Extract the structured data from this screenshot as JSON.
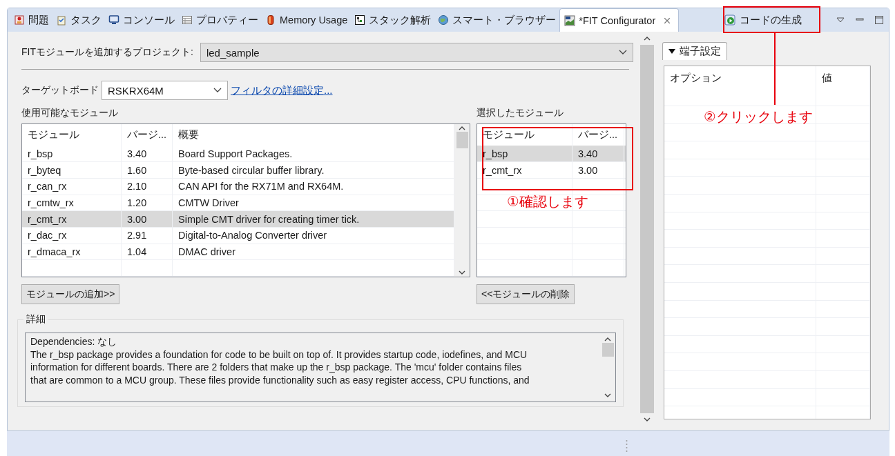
{
  "tabs": [
    {
      "label": "問題",
      "selected": false
    },
    {
      "label": "タスク",
      "selected": false
    },
    {
      "label": "コンソール",
      "selected": false
    },
    {
      "label": "プロパティー",
      "selected": false
    },
    {
      "label": "Memory Usage",
      "selected": false
    },
    {
      "label": "スタック解析",
      "selected": false
    },
    {
      "label": "スマート・ブラウザー",
      "selected": false
    },
    {
      "label": "*FIT Configurator",
      "selected": true
    }
  ],
  "toolbar": {
    "generate_button": "コードの生成"
  },
  "project": {
    "label": "FITモジュールを追加するプロジェクト:",
    "value": "led_sample"
  },
  "target_board": {
    "label": "ターゲットボード",
    "value": "RSKRX64M",
    "filter_link": "フィルタの詳細設定..."
  },
  "available_modules": {
    "title": "使用可能なモジュール",
    "columns": [
      "モジュール",
      "バージ...",
      "概要"
    ],
    "rows": [
      {
        "cells": [
          "r_bsp",
          "3.40",
          "Board Support Packages."
        ],
        "selected": false
      },
      {
        "cells": [
          "r_byteq",
          "1.60",
          "Byte-based circular buffer library."
        ],
        "selected": false
      },
      {
        "cells": [
          "r_can_rx",
          "2.10",
          "CAN API for the RX71M and RX64M."
        ],
        "selected": false
      },
      {
        "cells": [
          "r_cmtw_rx",
          "1.20",
          "CMTW Driver"
        ],
        "selected": false
      },
      {
        "cells": [
          "r_cmt_rx",
          "3.00",
          "Simple CMT driver for creating timer tick."
        ],
        "selected": true
      },
      {
        "cells": [
          "r_dac_rx",
          "2.91",
          "Digital-to-Analog Converter driver"
        ],
        "selected": false
      },
      {
        "cells": [
          "r_dmaca_rx",
          "1.04",
          "DMAC driver"
        ],
        "selected": false
      }
    ],
    "add_button": "モジュールの追加>>"
  },
  "selected_modules": {
    "title": "選択したモジュール",
    "columns": [
      "モジュール",
      "バージ..."
    ],
    "rows": [
      {
        "cells": [
          "r_bsp",
          "3.40"
        ],
        "selected": true
      },
      {
        "cells": [
          "r_cmt_rx",
          "3.00"
        ],
        "selected": false
      }
    ],
    "remove_button": "<<モジュールの削除"
  },
  "details": {
    "title": "詳細",
    "lines": [
      "Dependencies: なし",
      "The r_bsp package provides a foundation for code to be built on top of. It provides startup code, iodefines, and MCU",
      "information for different boards. There are 2 folders that make up the r_bsp package. The 'mcu' folder contains files",
      "that are common to a MCU group. These files provide functionality such as easy register access, CPU functions, and"
    ]
  },
  "pin_settings": {
    "section": "端子設定",
    "expanded": true,
    "columns": [
      "オプション",
      "値"
    ]
  },
  "annotations": [
    {
      "text": "①確認します"
    },
    {
      "text": "②クリックします"
    }
  ]
}
